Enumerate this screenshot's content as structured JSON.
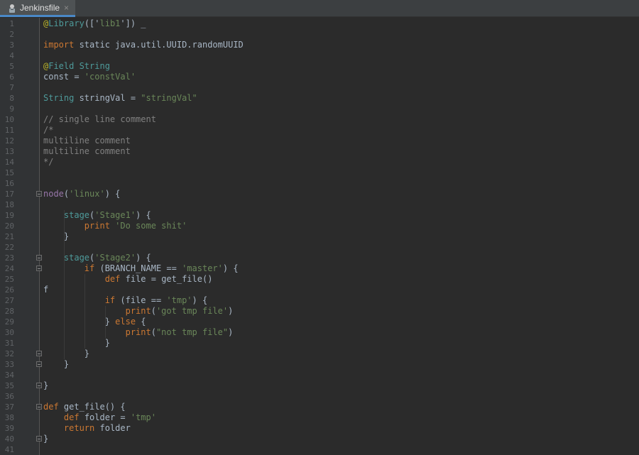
{
  "tab": {
    "label": "Jenkinsfile",
    "close": "×"
  },
  "lines": [
    {
      "n": "1",
      "tokens": [
        [
          "a",
          "@"
        ],
        [
          "t",
          "Library"
        ],
        [
          "f",
          "(['"
        ],
        [
          "s",
          "lib1"
        ],
        [
          "f",
          "']) _"
        ]
      ]
    },
    {
      "n": "2",
      "tokens": []
    },
    {
      "n": "3",
      "tokens": [
        [
          "k",
          "import"
        ],
        [
          "f",
          " static java.util.UUID.randomUUID"
        ]
      ]
    },
    {
      "n": "4",
      "tokens": []
    },
    {
      "n": "5",
      "tokens": [
        [
          "a",
          "@"
        ],
        [
          "t",
          "Field String"
        ]
      ]
    },
    {
      "n": "6",
      "tokens": [
        [
          "f",
          "const = "
        ],
        [
          "s",
          "'constVal'"
        ]
      ]
    },
    {
      "n": "7",
      "tokens": []
    },
    {
      "n": "8",
      "tokens": [
        [
          "t",
          "String"
        ],
        [
          "f",
          " stringVal = "
        ],
        [
          "s",
          "\"stringVal\""
        ]
      ]
    },
    {
      "n": "9",
      "tokens": []
    },
    {
      "n": "10",
      "tokens": [
        [
          "c",
          "// single line comment"
        ]
      ]
    },
    {
      "n": "11",
      "tokens": [
        [
          "c",
          "/*"
        ]
      ]
    },
    {
      "n": "12",
      "tokens": [
        [
          "c",
          "multiline comment"
        ]
      ]
    },
    {
      "n": "13",
      "tokens": [
        [
          "c",
          "multiline comment"
        ]
      ]
    },
    {
      "n": "14",
      "tokens": [
        [
          "c",
          "*/"
        ]
      ]
    },
    {
      "n": "15",
      "tokens": []
    },
    {
      "n": "16",
      "tokens": []
    },
    {
      "n": "17",
      "tokens": [
        [
          "n",
          "node"
        ],
        [
          "f",
          "("
        ],
        [
          "s",
          "'linux'"
        ],
        [
          "f",
          ") {"
        ]
      ]
    },
    {
      "n": "18",
      "tokens": []
    },
    {
      "n": "19",
      "tokens": [
        [
          "f",
          "    "
        ],
        [
          "t",
          "stage"
        ],
        [
          "f",
          "("
        ],
        [
          "s",
          "'Stage1'"
        ],
        [
          "f",
          ") {"
        ]
      ]
    },
    {
      "n": "20",
      "tokens": [
        [
          "f",
          "        "
        ],
        [
          "k",
          "print"
        ],
        [
          "f",
          " "
        ],
        [
          "s",
          "'Do some shit'"
        ]
      ]
    },
    {
      "n": "21",
      "tokens": [
        [
          "f",
          "    }"
        ]
      ]
    },
    {
      "n": "22",
      "tokens": []
    },
    {
      "n": "23",
      "tokens": [
        [
          "f",
          "    "
        ],
        [
          "t",
          "stage"
        ],
        [
          "f",
          "("
        ],
        [
          "s",
          "'Stage2'"
        ],
        [
          "f",
          ") {"
        ]
      ]
    },
    {
      "n": "24",
      "tokens": [
        [
          "f",
          "        "
        ],
        [
          "k",
          "if"
        ],
        [
          "f",
          " (BRANCH_NAME == "
        ],
        [
          "s",
          "'master'"
        ],
        [
          "f",
          ") {"
        ]
      ]
    },
    {
      "n": "25",
      "tokens": [
        [
          "f",
          "            "
        ],
        [
          "k",
          "def"
        ],
        [
          "f",
          " file = get_file()"
        ]
      ]
    },
    {
      "n": "26",
      "tokens": [
        [
          "f",
          "f"
        ]
      ]
    },
    {
      "n": "27",
      "tokens": [
        [
          "f",
          "            "
        ],
        [
          "k",
          "if"
        ],
        [
          "f",
          " (file == "
        ],
        [
          "s",
          "'tmp'"
        ],
        [
          "f",
          ") {"
        ]
      ]
    },
    {
      "n": "28",
      "tokens": [
        [
          "f",
          "                "
        ],
        [
          "k",
          "print"
        ],
        [
          "f",
          "("
        ],
        [
          "s",
          "'got tmp file'"
        ],
        [
          "f",
          ")"
        ]
      ]
    },
    {
      "n": "29",
      "tokens": [
        [
          "f",
          "            } "
        ],
        [
          "k",
          "else"
        ],
        [
          "f",
          " {"
        ]
      ]
    },
    {
      "n": "30",
      "tokens": [
        [
          "f",
          "                "
        ],
        [
          "k",
          "print"
        ],
        [
          "f",
          "("
        ],
        [
          "s",
          "\"not tmp file\""
        ],
        [
          "f",
          ")"
        ]
      ]
    },
    {
      "n": "31",
      "tokens": [
        [
          "f",
          "            }"
        ]
      ]
    },
    {
      "n": "32",
      "tokens": [
        [
          "f",
          "        }"
        ]
      ]
    },
    {
      "n": "33",
      "tokens": [
        [
          "f",
          "    }"
        ]
      ]
    },
    {
      "n": "34",
      "tokens": []
    },
    {
      "n": "35",
      "tokens": [
        [
          "f",
          "}"
        ]
      ]
    },
    {
      "n": "36",
      "tokens": []
    },
    {
      "n": "37",
      "tokens": [
        [
          "k",
          "def"
        ],
        [
          "f",
          " get_file() {"
        ]
      ]
    },
    {
      "n": "38",
      "tokens": [
        [
          "f",
          "    "
        ],
        [
          "k",
          "def"
        ],
        [
          "f",
          " folder = "
        ],
        [
          "s",
          "'tmp'"
        ]
      ]
    },
    {
      "n": "39",
      "tokens": [
        [
          "f",
          "    "
        ],
        [
          "k",
          "return"
        ],
        [
          "f",
          " folder"
        ]
      ]
    },
    {
      "n": "40",
      "tokens": [
        [
          "f",
          "}"
        ]
      ]
    },
    {
      "n": "41",
      "tokens": []
    }
  ],
  "fold_markers_at_lines": [
    "17",
    "23",
    "24",
    "32",
    "33",
    "35",
    "37",
    "40"
  ],
  "colors": {
    "background": "#2b2b2b",
    "gutter": "#313335",
    "keyword": "#cc7832",
    "string": "#6a8759",
    "annotation": "#bbb529",
    "comment": "#808080",
    "type": "#4e9a9a",
    "identifier": "#9876aa",
    "text": "#a9b7c6",
    "tab_underline": "#4a88c7"
  }
}
